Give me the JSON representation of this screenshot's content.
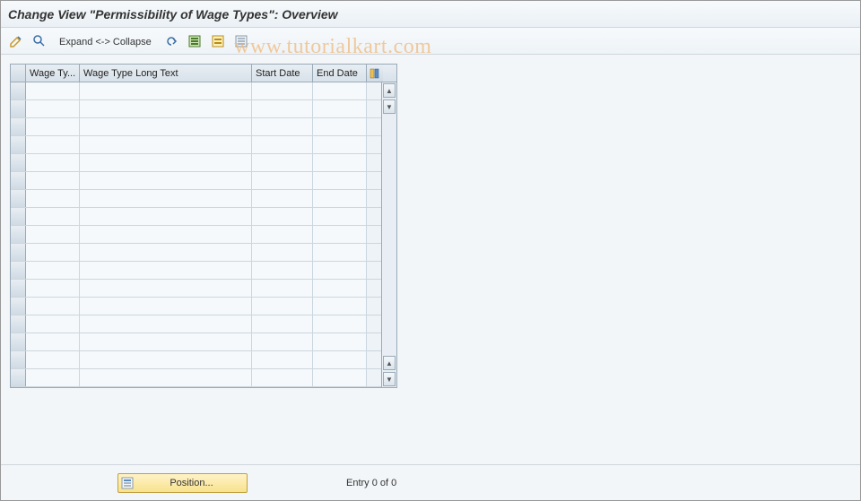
{
  "title": "Change View \"Permissibility of Wage Types\": Overview",
  "toolbar": {
    "expand_collapse": "Expand <-> Collapse"
  },
  "table": {
    "columns": {
      "wage_type": "Wage Ty...",
      "long_text": "Wage Type Long Text",
      "start_date": "Start Date",
      "end_date": "End Date"
    },
    "row_count": 17
  },
  "footer": {
    "position_button": "Position...",
    "entry_text": "Entry 0 of 0"
  },
  "watermark": "www.tutorialkart.com"
}
